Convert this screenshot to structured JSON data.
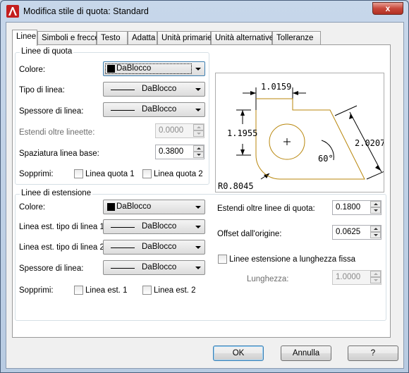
{
  "window": {
    "title": "Modifica stile di quota: Standard",
    "close_glyph": "x"
  },
  "tabs": [
    "Linee",
    "Simboli e frecce",
    "Testo",
    "Adatta",
    "Unità primarie",
    "Unità alternative",
    "Tolleranze"
  ],
  "dim_lines": {
    "title": "Linee di quota",
    "color_label": "Colore:",
    "color_value": "DaBlocco",
    "linetype_label": "Tipo di linea:",
    "linetype_value": "DaBlocco",
    "lineweight_label": "Spessore di linea:",
    "lineweight_value": "DaBlocco",
    "extend_ticks_label": "Estendi oltre lineette:",
    "extend_ticks_value": "0.0000",
    "baseline_spacing_label": "Spaziatura linea base:",
    "baseline_spacing_value": "0.3800",
    "suppress_label": "Sopprimi:",
    "suppress_1": "Linea quota 1",
    "suppress_2": "Linea quota 2"
  },
  "ext_lines": {
    "title": "Linee di estensione",
    "color_label": "Colore:",
    "color_value": "DaBlocco",
    "linetype1_label": "Linea est. tipo di linea 1:",
    "linetype1_value": "DaBlocco",
    "linetype2_label": "Linea est. tipo di linea 2:",
    "linetype2_value": "DaBlocco",
    "lineweight_label": "Spessore di linea:",
    "lineweight_value": "DaBlocco",
    "suppress_label": "Sopprimi:",
    "suppress_1": "Linea est. 1",
    "suppress_2": "Linea est. 2",
    "extend_beyond_label": "Estendi oltre linee di quota:",
    "extend_beyond_value": "0.1800",
    "offset_label": "Offset dall'origine:",
    "offset_value": "0.0625",
    "fixed_length_label": "Linee estensione a lunghezza fissa",
    "length_label": "Lunghezza:",
    "length_value": "1.0000"
  },
  "preview": {
    "dim_top": "1.0159",
    "dim_left": "1.1955",
    "dim_right": "2.0207",
    "angle": "60°",
    "radius": "R0.8045"
  },
  "buttons": {
    "ok": "OK",
    "cancel": "Annulla",
    "help": "?"
  },
  "colors": {
    "preview_outline": "#b8860b",
    "default_border": "#3c7fb1"
  }
}
